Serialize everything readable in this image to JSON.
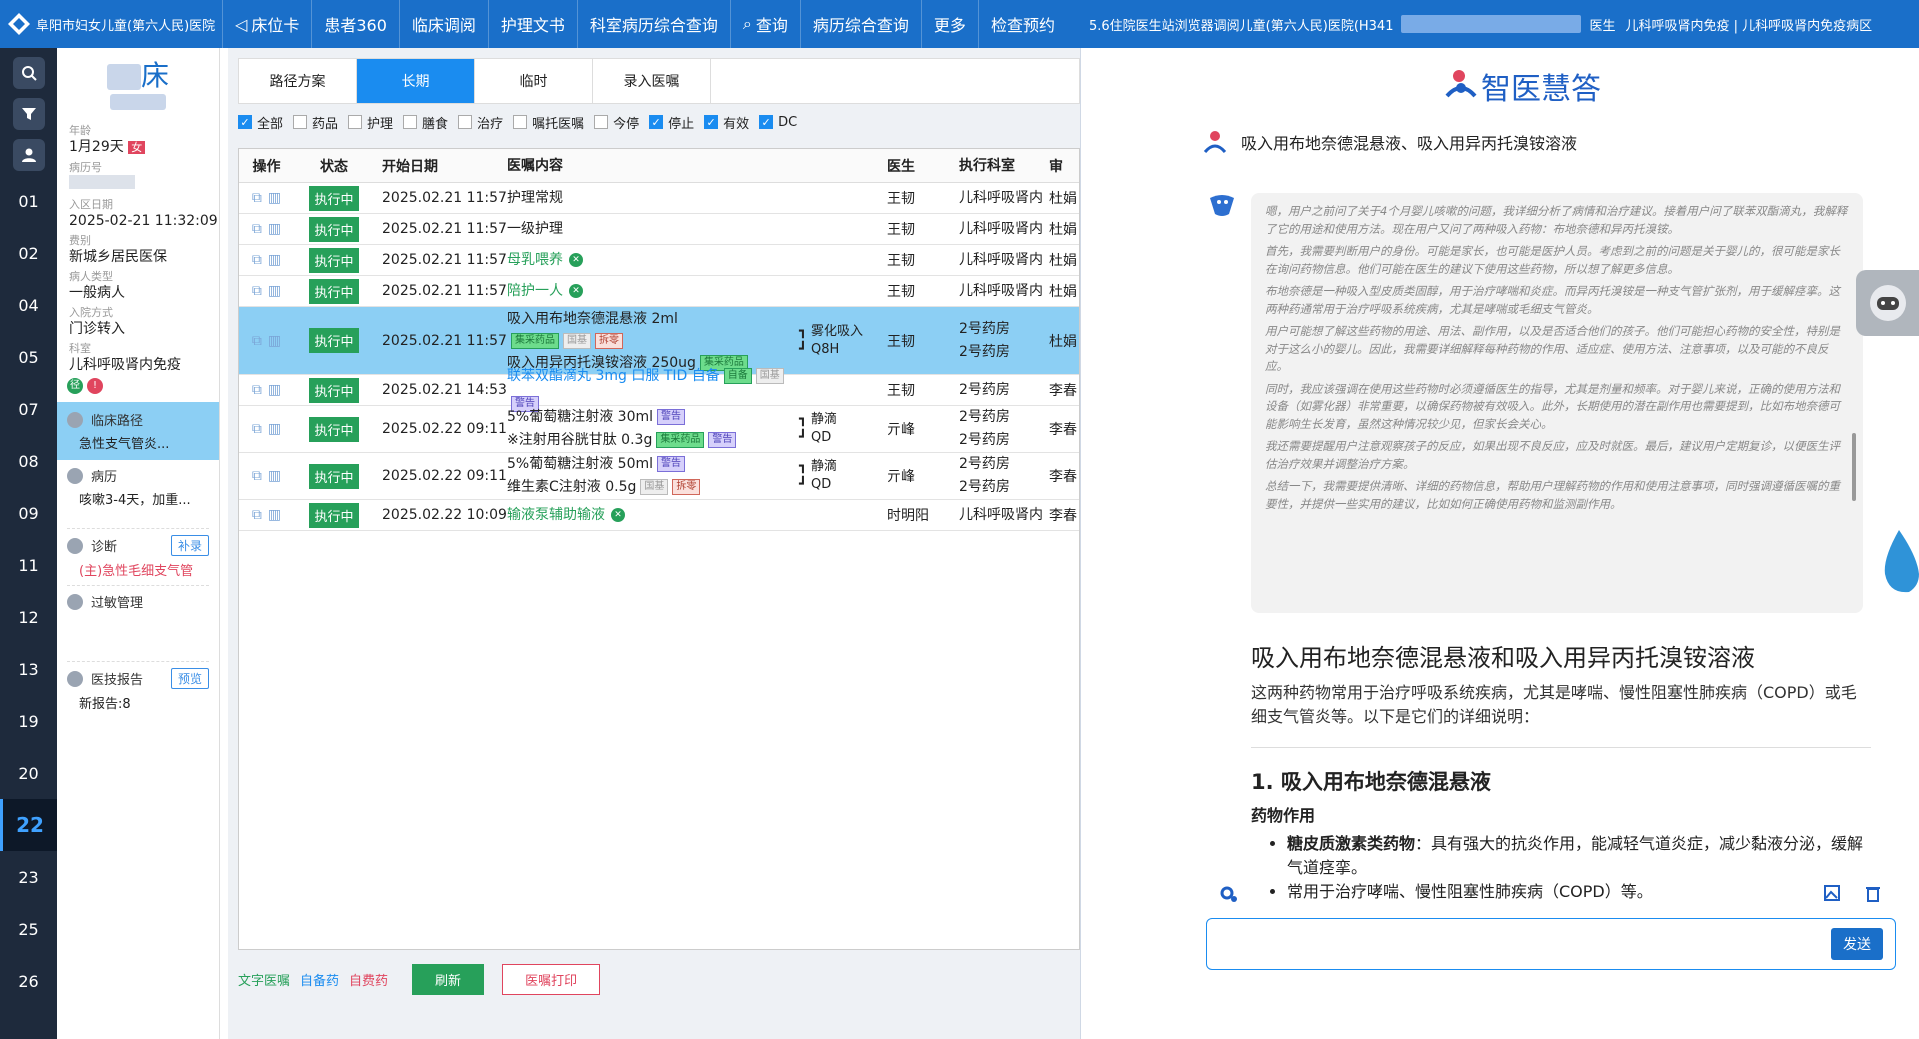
{
  "header": {
    "hospital": "阜阳市妇女儿童(第六人民)医院",
    "nav": [
      {
        "label": "床位卡",
        "icon": "back-circle-icon"
      },
      {
        "label": "患者360"
      },
      {
        "label": "临床调阅"
      },
      {
        "label": "护理文书"
      },
      {
        "label": "科室病历综合查询"
      },
      {
        "label": "查询",
        "icon": "search-icon"
      },
      {
        "label": "病历综合查询"
      },
      {
        "label": "更多"
      },
      {
        "label": "检查预约"
      }
    ],
    "title": "5.6住院医生站浏览器调阅儿童(第六人民)医院(H341",
    "user_role": "医生",
    "dept": "儿科呼吸肾内免疫 | 儿科呼吸肾内免疫病区"
  },
  "beds": [
    "01",
    "02",
    "04",
    "05",
    "07",
    "08",
    "09",
    "11",
    "12",
    "13",
    "19",
    "20",
    "22",
    "23",
    "25",
    "26"
  ],
  "active_bed": "22",
  "patient": {
    "bed_suffix": "床",
    "age_label": "年龄",
    "age": "1月29天",
    "gender": "女",
    "mrn_label": "病历号",
    "admit_label": "入区日期",
    "admit": "2025-02-21 11:32:09",
    "fee_label": "费别",
    "fee": "新城乡居民医保",
    "type_label": "病人类型",
    "type": "一般病人",
    "way_label": "入院方式",
    "way": "门诊转入",
    "dept_label": "科室",
    "dept": "儿科呼吸肾内免疫",
    "pathway": "临床路径",
    "pathway_sub": "急性支气管炎...",
    "history": "病历",
    "history_sub": "咳嗽3-4天，加重...",
    "diag": "诊断",
    "diag_btn": "补录",
    "diag_sub": "(主)急性毛细支气管",
    "allergy": "过敏管理",
    "report": "医技报告",
    "report_btn": "预览",
    "report_sub": "新报告:8"
  },
  "tabs": [
    "路径方案",
    "长期",
    "临时",
    "录入医嘱"
  ],
  "active_tab": "长期",
  "filters": [
    {
      "label": "全部",
      "checked": true
    },
    {
      "label": "药品",
      "checked": false
    },
    {
      "label": "护理",
      "checked": false
    },
    {
      "label": "膳食",
      "checked": false
    },
    {
      "label": "治疗",
      "checked": false
    },
    {
      "label": "嘱托医嘱",
      "checked": false
    },
    {
      "label": "今停",
      "checked": false
    },
    {
      "label": "停止",
      "checked": true
    },
    {
      "label": "有效",
      "checked": true
    },
    {
      "label": "DC",
      "checked": true
    }
  ],
  "columns": [
    "操作",
    "状态",
    "开始日期",
    "医嘱内容",
    "",
    "医生",
    "执行科室",
    "审"
  ],
  "rows": [
    {
      "status": "执行中",
      "date": "2025.02.21 11:57",
      "items": [
        {
          "text": "护理常规"
        }
      ],
      "doctor": "王韧",
      "dept": [
        "儿科呼吸肾内"
      ],
      "rev": "杜娟"
    },
    {
      "status": "执行中",
      "date": "2025.02.21 11:57",
      "items": [
        {
          "text": "一级护理"
        }
      ],
      "doctor": "王韧",
      "dept": [
        "儿科呼吸肾内"
      ],
      "rev": "杜娟"
    },
    {
      "status": "执行中",
      "date": "2025.02.21 11:57",
      "items": [
        {
          "text": "母乳喂养",
          "green": true,
          "x": true
        }
      ],
      "doctor": "王韧",
      "dept": [
        "儿科呼吸肾内"
      ],
      "rev": "杜娟"
    },
    {
      "status": "执行中",
      "date": "2025.02.21 11:57",
      "items": [
        {
          "text": "陪护一人",
          "green": true,
          "x": true
        }
      ],
      "doctor": "王韧",
      "dept": [
        "儿科呼吸肾内"
      ],
      "rev": "杜娟"
    },
    {
      "status": "执行中",
      "date": "2025.02.21 11:57",
      "items": [
        {
          "text": "吸入用布地奈德混悬液 2ml",
          "tags": []
        },
        {
          "text": "",
          "tags": [
            [
              "集采药品",
              "g"
            ],
            [
              "国基",
              "gr"
            ],
            [
              "拆零",
              "r"
            ]
          ]
        },
        {
          "text": "吸入用异丙托溴铵溶液 250ug",
          "tags": [
            [
              "集采药品",
              "g"
            ]
          ]
        }
      ],
      "route": [
        "雾化吸入",
        "Q8H"
      ],
      "doctor": "王韧",
      "dept": [
        "2号药房",
        "2号药房"
      ],
      "rev": "杜娟",
      "sel": true
    },
    {
      "status": "执行中",
      "date": "2025.02.21 14:53",
      "items": [
        {
          "text": "联苯双酯滴丸 3mg 口服 TID 自备",
          "blue": true,
          "tags": [
            [
              "自备",
              "g"
            ],
            [
              "国基",
              "gr"
            ],
            [
              "警告",
              "b"
            ]
          ]
        }
      ],
      "doctor": "王韧",
      "dept": [
        "2号药房"
      ],
      "rev": "李春"
    },
    {
      "status": "执行中",
      "date": "2025.02.22 09:11",
      "items": [
        {
          "text": "5%葡萄糖注射液 30ml",
          "tags": [
            [
              "警告",
              "b"
            ]
          ]
        },
        {
          "text": "※注射用谷胱甘肽 0.3g",
          "tags": [
            [
              "集采药品",
              "g"
            ],
            [
              "警告",
              "b"
            ]
          ]
        }
      ],
      "route": [
        "静滴",
        "QD"
      ],
      "doctor": "亓峰",
      "dept": [
        "2号药房",
        "2号药房"
      ],
      "rev": "李春"
    },
    {
      "status": "执行中",
      "date": "2025.02.22 09:11",
      "items": [
        {
          "text": "5%葡萄糖注射液 50ml",
          "tags": [
            [
              "警告",
              "b"
            ]
          ]
        },
        {
          "text": "维生素C注射液 0.5g",
          "tags": [
            [
              "国基",
              "gr"
            ],
            [
              "拆零",
              "r"
            ]
          ]
        }
      ],
      "route": [
        "静滴",
        "QD"
      ],
      "doctor": "亓峰",
      "dept": [
        "2号药房",
        "2号药房"
      ],
      "rev": "李春"
    },
    {
      "status": "执行中",
      "date": "2025.02.22 10:09",
      "items": [
        {
          "text": "输液泵辅助输液",
          "green": true,
          "x": true
        }
      ],
      "doctor": "时明阳",
      "dept": [
        "儿科呼吸肾内"
      ],
      "rev": "李春"
    }
  ],
  "footer": {
    "legend": [
      {
        "label": "文字医嘱",
        "color": "#27a05a"
      },
      {
        "label": "自备药",
        "color": "#1a8cf0"
      },
      {
        "label": "自费药",
        "color": "#e0455e"
      }
    ],
    "refresh": "刷新",
    "print": "医嘱打印"
  },
  "ai": {
    "brand": "智医慧答",
    "question": "吸入用布地奈德混悬液、吸入用异丙托溴铵溶液",
    "thinking": [
      "嗯，用户之前问了关于4个月婴儿咳嗽的问题，我详细分析了病情和治疗建议。接着用户问了联苯双酯滴丸，我解释了它的用途和使用方法。现在用户又问了两种吸入药物：布地奈德和异丙托溴铵。",
      "首先，我需要判断用户的身份。可能是家长，也可能是医护人员。考虑到之前的问题是关于婴儿的，很可能是家长在询问药物信息。他们可能在医生的建议下使用这些药物，所以想了解更多信息。",
      "布地奈德是一种吸入型皮质类固醇，用于治疗哮喘和炎症。而异丙托溴铵是一种支气管扩张剂，用于缓解痉挛。这两种药通常用于治疗呼吸系统疾病，尤其是哮喘或毛细支气管炎。",
      "用户可能想了解这些药物的用途、用法、副作用，以及是否适合他们的孩子。他们可能担心药物的安全性，特别是对于这么小的婴儿。因此，我需要详细解释每种药物的作用、适应症、使用方法、注意事项，以及可能的不良反应。",
      "同时，我应该强调在使用这些药物时必须遵循医生的指导，尤其是剂量和频率。对于婴儿来说，正确的使用方法和设备（如雾化器）非常重要，以确保药物被有效吸入。此外，长期使用的潜在副作用也需要提到，比如布地奈德可能影响生长发育，虽然这种情况较少见，但家长会关心。",
      "我还需要提醒用户注意观察孩子的反应，如果出现不良反应，应及时就医。最后，建议用户定期复诊，以便医生评估治疗效果并调整治疗方案。",
      "总结一下，我需要提供清晰、详细的药物信息，帮助用户理解药物的作用和使用注意事项，同时强调遵循医嘱的重要性，并提供一些实用的建议，比如如何正确使用药物和监测副作用。"
    ],
    "answer_title": "吸入用布地奈德混悬液和吸入用异丙托溴铵溶液",
    "answer_intro": "这两种药物常用于治疗呼吸系统疾病，尤其是哮喘、慢性阻塞性肺疾病（COPD）或毛细支气管炎等。以下是它们的详细说明：",
    "h3": "1. 吸入用布地奈德混悬液",
    "h4": "药物作用",
    "bullets": [
      {
        "b": "糖皮质激素类药物",
        "t": "：具有强大的抗炎作用，能减轻气道炎症，减少黏液分泌，缓解气道痉挛。"
      },
      {
        "b": "",
        "t": "常用于治疗哮喘、慢性阻塞性肺疾病（COPD）等。"
      }
    ],
    "send": "发送",
    "input": ""
  }
}
